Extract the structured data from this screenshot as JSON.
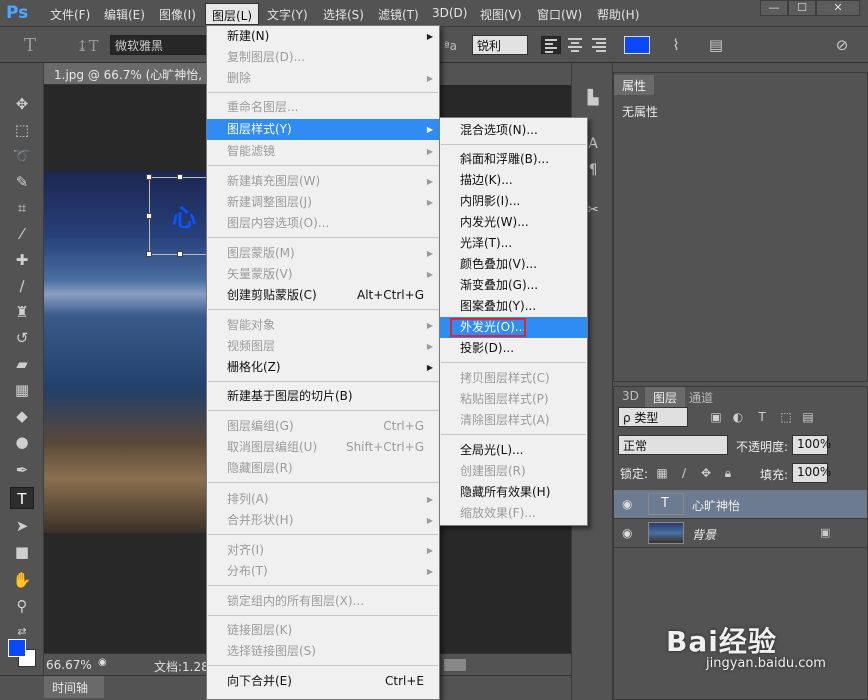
{
  "app": {
    "logo": "Ps"
  },
  "menubar": {
    "items": [
      "文件(F)",
      "编辑(E)",
      "图像(I)",
      "图层(L)",
      "文字(Y)",
      "选择(S)",
      "滤镜(T)",
      "3D(D)",
      "视图(V)",
      "窗口(W)",
      "帮助(H)"
    ],
    "active_item": "图层(L)"
  },
  "window_controls": {
    "minimize": "—",
    "restore": "☐",
    "close": "✕"
  },
  "options_bar": {
    "font_family": "微软雅黑",
    "aa_label": "ªa",
    "antialias": "锐利",
    "text_color": "#0a48ff"
  },
  "document": {
    "tab_title": "1.jpg @ 66.7% (心旷神怡, RGB/8",
    "layer_glyph": "心",
    "zoom": "66.67%",
    "doc_info": "文档:1.28"
  },
  "timeline": {
    "label": "时间轴"
  },
  "layer_menu": {
    "items": [
      {
        "label": "新建(N)",
        "submenu": true,
        "disabled": false
      },
      {
        "label": "复制图层(D)...",
        "disabled": true
      },
      {
        "label": "删除",
        "submenu": true,
        "disabled": true
      },
      {
        "label": "重命名图层...",
        "disabled": true
      },
      {
        "label": "图层样式(Y)",
        "submenu": true,
        "highlighted": true
      },
      {
        "label": "智能滤镜",
        "submenu": true,
        "disabled": true
      },
      {
        "label": "新建填充图层(W)",
        "submenu": true,
        "disabled": true
      },
      {
        "label": "新建调整图层(J)",
        "submenu": true,
        "disabled": true
      },
      {
        "label": "图层内容选项(O)...",
        "disabled": true
      },
      {
        "label": "图层蒙版(M)",
        "submenu": true,
        "disabled": true
      },
      {
        "label": "矢量蒙版(V)",
        "submenu": true,
        "disabled": true
      },
      {
        "label": "创建剪贴蒙版(C)",
        "shortcut": "Alt+Ctrl+G",
        "disabled": false
      },
      {
        "label": "智能对象",
        "submenu": true,
        "disabled": true
      },
      {
        "label": "视频图层",
        "submenu": true,
        "disabled": true
      },
      {
        "label": "栅格化(Z)",
        "submenu": true,
        "disabled": false
      },
      {
        "label": "新建基于图层的切片(B)",
        "disabled": false
      },
      {
        "label": "图层编组(G)",
        "shortcut": "Ctrl+G",
        "disabled": true
      },
      {
        "label": "取消图层编组(U)",
        "shortcut": "Shift+Ctrl+G",
        "disabled": true
      },
      {
        "label": "隐藏图层(R)",
        "disabled": true
      },
      {
        "label": "排列(A)",
        "submenu": true,
        "disabled": true
      },
      {
        "label": "合并形状(H)",
        "submenu": true,
        "disabled": true
      },
      {
        "label": "对齐(I)",
        "submenu": true,
        "disabled": true
      },
      {
        "label": "分布(T)",
        "submenu": true,
        "disabled": true
      },
      {
        "label": "锁定组内的所有图层(X)...",
        "disabled": true
      },
      {
        "label": "链接图层(K)",
        "disabled": true
      },
      {
        "label": "选择链接图层(S)",
        "disabled": true
      },
      {
        "label": "向下合并(E)",
        "shortcut": "Ctrl+E",
        "disabled": false
      }
    ]
  },
  "style_submenu": {
    "items": [
      {
        "label": "混合选项(N)...",
        "disabled": false
      },
      {
        "label": "斜面和浮雕(B)...",
        "disabled": false
      },
      {
        "label": "描边(K)...",
        "disabled": false
      },
      {
        "label": "内阴影(I)...",
        "disabled": false
      },
      {
        "label": "内发光(W)...",
        "disabled": false
      },
      {
        "label": "光泽(T)...",
        "disabled": false
      },
      {
        "label": "颜色叠加(V)...",
        "disabled": false
      },
      {
        "label": "渐变叠加(G)...",
        "disabled": false
      },
      {
        "label": "图案叠加(Y)...",
        "disabled": false
      },
      {
        "label": "外发光(O)...",
        "highlighted": true
      },
      {
        "label": "投影(D)...",
        "disabled": false
      },
      {
        "label": "拷贝图层样式(C)",
        "disabled": true
      },
      {
        "label": "粘贴图层样式(P)",
        "disabled": true
      },
      {
        "label": "清除图层样式(A)",
        "disabled": true
      },
      {
        "label": "全局光(L)...",
        "disabled": false
      },
      {
        "label": "创建图层(R)",
        "disabled": true
      },
      {
        "label": "隐藏所有效果(H)",
        "disabled": false
      },
      {
        "label": "缩放效果(F)...",
        "disabled": true
      }
    ]
  },
  "properties_panel": {
    "tab": "属性",
    "content": "无属性"
  },
  "layers_panel": {
    "tabs": [
      "3D",
      "图层",
      "通道"
    ],
    "active_tab": "图层",
    "filter": "ρ 类型",
    "blend_mode": "正常",
    "opacity_label": "不透明度:",
    "opacity": "100%",
    "lock_label": "锁定:",
    "fill_label": "填充:",
    "fill": "100%",
    "layers": [
      {
        "name": "心旷神怡",
        "selected": true
      },
      {
        "name": "背景",
        "locked": true
      }
    ]
  },
  "watermark": {
    "brand": "Bai经验",
    "url": "jingyan.baidu.com"
  }
}
